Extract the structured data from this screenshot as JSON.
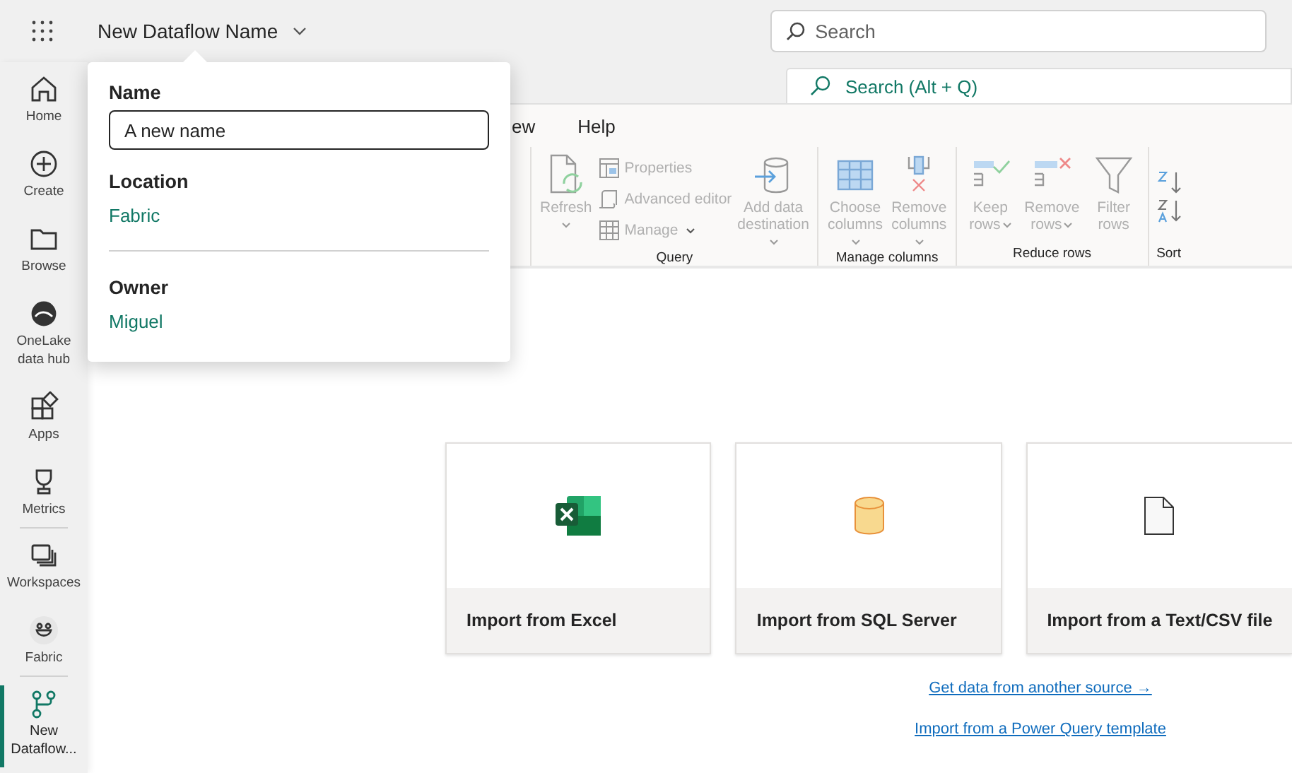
{
  "header": {
    "title": "New Dataflow Name",
    "search": {
      "placeholder": "Search"
    }
  },
  "rail": [
    {
      "label": "Home",
      "selected": false,
      "divider_after": false
    },
    {
      "label": "Create",
      "selected": false,
      "divider_after": false
    },
    {
      "label": "Browse",
      "selected": false,
      "divider_after": false
    },
    {
      "label": "OneLake data hub",
      "selected": false,
      "divider_after": false
    },
    {
      "label": "Apps",
      "selected": false,
      "divider_after": false
    },
    {
      "label": "Metrics",
      "selected": false,
      "divider_after": true
    },
    {
      "label": "Workspaces",
      "selected": false,
      "divider_after": false
    },
    {
      "label": "Fabric",
      "selected": false,
      "divider_after": true
    },
    {
      "label": "New Dataflow...",
      "selected": true,
      "divider_after": false
    }
  ],
  "editor_search": {
    "placeholder": "Search (Alt + Q)"
  },
  "ribbon_tabs": [
    {
      "label": "ew",
      "selected": false
    },
    {
      "label": "Help",
      "selected": false
    }
  ],
  "ribbon_groups": [
    {
      "name": "Query",
      "kind": "buttons",
      "columns": [
        [
          {
            "label": "Refresh",
            "kind": "large",
            "dropdown": true,
            "disabled": true
          }
        ],
        [
          {
            "label": "Properties",
            "kind": "small",
            "dropdown": false,
            "disabled": true
          },
          {
            "label": "Advanced editor",
            "kind": "small",
            "dropdown": false,
            "disabled": true
          },
          {
            "label": "Manage",
            "kind": "small",
            "dropdown": true,
            "disabled": true
          }
        ],
        [
          {
            "label": "Add data destination",
            "kind": "large",
            "dropdown": true,
            "disabled": true
          }
        ]
      ]
    },
    {
      "name": "Manage columns",
      "kind": "buttons",
      "columns": [
        [
          {
            "label": "Choose columns",
            "kind": "large",
            "dropdown": true,
            "disabled": true
          }
        ],
        [
          {
            "label": "Remove columns",
            "kind": "large",
            "dropdown": true,
            "disabled": true
          }
        ]
      ]
    },
    {
      "name": "Reduce rows",
      "kind": "buttons",
      "columns": [
        [
          {
            "label": "Keep rows",
            "kind": "large",
            "dropdown": true,
            "disabled": true
          }
        ],
        [
          {
            "label": "Remove rows",
            "kind": "large",
            "dropdown": true,
            "disabled": true
          }
        ],
        [
          {
            "label": "Filter rows",
            "kind": "large",
            "dropdown": false,
            "disabled": true
          }
        ]
      ]
    },
    {
      "name": "Sort",
      "kind": "sort"
    }
  ],
  "popup": {
    "name_label": "Name",
    "name_value": "A new name",
    "location_label": "Location",
    "location_value": "Fabric",
    "owner_label": "Owner",
    "owner_value": "Miguel"
  },
  "cards": [
    {
      "label": "Import from Excel"
    },
    {
      "label": "Import from SQL Server"
    },
    {
      "label": "Import from a Text/CSV file"
    }
  ],
  "links": [
    "Get data from another source →",
    "Import from a Power Query template"
  ]
}
